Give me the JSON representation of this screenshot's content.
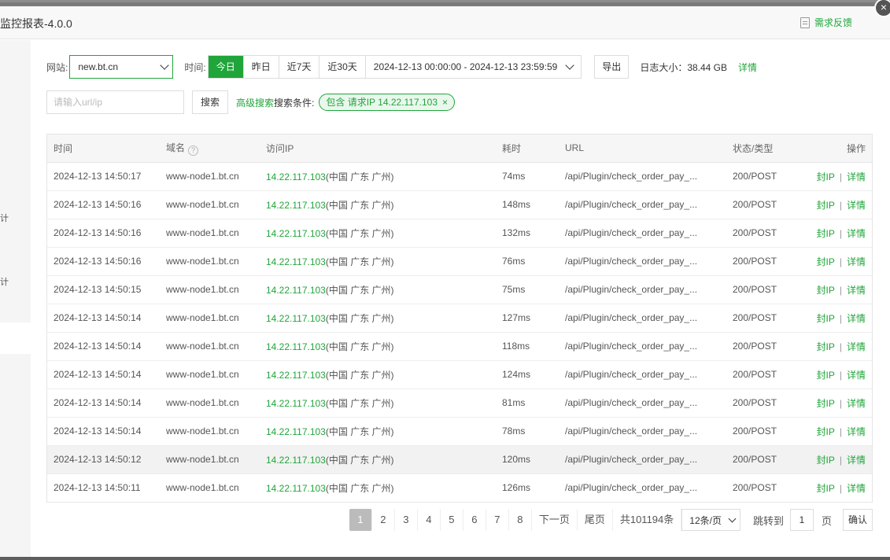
{
  "dialog": {
    "title": "监控报表-4.0.0",
    "feedback": "需求反馈",
    "close": "×"
  },
  "sidebar": {
    "fragment1": "计",
    "fragment2": "计"
  },
  "filters": {
    "site_label": "网站:",
    "site_value": "new.bt.cn",
    "time_label": "时间:",
    "time_buttons": [
      "今日",
      "昨日",
      "近7天",
      "近30天"
    ],
    "active_time": "今日",
    "range": "2024-12-13 00:00:00 - 2024-12-13 23:59:59",
    "export": "导出",
    "log_size": "日志大小：38.44 GB",
    "log_detail": "详情",
    "search_placeholder": "请输入url/ip",
    "search_button": "搜索",
    "advanced_search": "高级搜索",
    "condition_label": "搜索条件:",
    "condition_tag": "包含 请求IP 14.22.117.103",
    "condition_remove": "×"
  },
  "table": {
    "headers": {
      "time": "时间",
      "domain": "域名",
      "ip": "访问IP",
      "cost": "耗时",
      "url": "URL",
      "status": "状态/类型",
      "ops": "操作"
    },
    "help_icon": "?",
    "op_block": "封IP",
    "op_detail": "详情",
    "op_sep": "|",
    "rows": [
      {
        "time": "2024-12-13 14:50:17",
        "domain": "www-node1.bt.cn",
        "ip": "14.22.117.103",
        "loc": "(中国 广东 广州)",
        "cost": "74ms",
        "url": "/api/Plugin/check_order_pay_...",
        "status": "200/POST"
      },
      {
        "time": "2024-12-13 14:50:16",
        "domain": "www-node1.bt.cn",
        "ip": "14.22.117.103",
        "loc": "(中国 广东 广州)",
        "cost": "148ms",
        "url": "/api/Plugin/check_order_pay_...",
        "status": "200/POST"
      },
      {
        "time": "2024-12-13 14:50:16",
        "domain": "www-node1.bt.cn",
        "ip": "14.22.117.103",
        "loc": "(中国 广东 广州)",
        "cost": "132ms",
        "url": "/api/Plugin/check_order_pay_...",
        "status": "200/POST"
      },
      {
        "time": "2024-12-13 14:50:16",
        "domain": "www-node1.bt.cn",
        "ip": "14.22.117.103",
        "loc": "(中国 广东 广州)",
        "cost": "76ms",
        "url": "/api/Plugin/check_order_pay_...",
        "status": "200/POST"
      },
      {
        "time": "2024-12-13 14:50:15",
        "domain": "www-node1.bt.cn",
        "ip": "14.22.117.103",
        "loc": "(中国 广东 广州)",
        "cost": "75ms",
        "url": "/api/Plugin/check_order_pay_...",
        "status": "200/POST"
      },
      {
        "time": "2024-12-13 14:50:14",
        "domain": "www-node1.bt.cn",
        "ip": "14.22.117.103",
        "loc": "(中国 广东 广州)",
        "cost": "127ms",
        "url": "/api/Plugin/check_order_pay_...",
        "status": "200/POST"
      },
      {
        "time": "2024-12-13 14:50:14",
        "domain": "www-node1.bt.cn",
        "ip": "14.22.117.103",
        "loc": "(中国 广东 广州)",
        "cost": "118ms",
        "url": "/api/Plugin/check_order_pay_...",
        "status": "200/POST"
      },
      {
        "time": "2024-12-13 14:50:14",
        "domain": "www-node1.bt.cn",
        "ip": "14.22.117.103",
        "loc": "(中国 广东 广州)",
        "cost": "124ms",
        "url": "/api/Plugin/check_order_pay_...",
        "status": "200/POST"
      },
      {
        "time": "2024-12-13 14:50:14",
        "domain": "www-node1.bt.cn",
        "ip": "14.22.117.103",
        "loc": "(中国 广东 广州)",
        "cost": "81ms",
        "url": "/api/Plugin/check_order_pay_...",
        "status": "200/POST"
      },
      {
        "time": "2024-12-13 14:50:14",
        "domain": "www-node1.bt.cn",
        "ip": "14.22.117.103",
        "loc": "(中国 广东 广州)",
        "cost": "78ms",
        "url": "/api/Plugin/check_order_pay_...",
        "status": "200/POST"
      },
      {
        "time": "2024-12-13 14:50:12",
        "domain": "www-node1.bt.cn",
        "ip": "14.22.117.103",
        "loc": "(中国 广东 广州)",
        "cost": "120ms",
        "url": "/api/Plugin/check_order_pay_...",
        "status": "200/POST"
      },
      {
        "time": "2024-12-13 14:50:11",
        "domain": "www-node1.bt.cn",
        "ip": "14.22.117.103",
        "loc": "(中国 广东 广州)",
        "cost": "126ms",
        "url": "/api/Plugin/check_order_pay_...",
        "status": "200/POST"
      }
    ],
    "highlighted_row": 10
  },
  "pagination": {
    "pages": [
      "1",
      "2",
      "3",
      "4",
      "5",
      "6",
      "7",
      "8"
    ],
    "active_page": "1",
    "next": "下一页",
    "last": "尾页",
    "total": "共101194条",
    "per_page": "12条/页",
    "jump_label": "跳转到",
    "jump_value": "1",
    "page_unit": "页",
    "confirm": "确认"
  },
  "colors": {
    "accent": "#20a53a",
    "header_bg": "#f8f8f8",
    "side_bg": "#f5f5f5"
  }
}
